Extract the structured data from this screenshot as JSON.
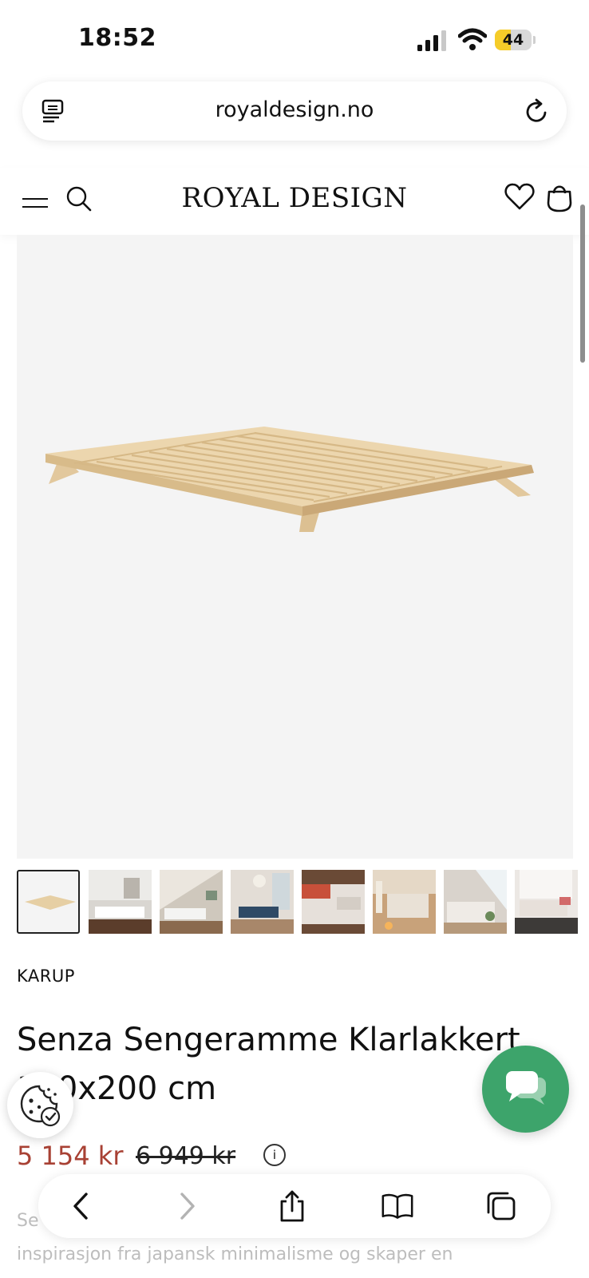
{
  "status_bar": {
    "time": "18:52",
    "battery": "44",
    "battery_level_percent": 44
  },
  "browser": {
    "url": "royaldesign.no"
  },
  "site": {
    "logo": "ROYAL DESIGN"
  },
  "product": {
    "brand": "KARUP",
    "title": "Senza Sengeramme Klarlakkert, 160x200 cm",
    "price": "5 154 kr",
    "old_price": "6 949 kr",
    "info_symbol": "i",
    "description_line1": "Se",
    "description_line2": "inspirasjon fra japansk minimalisme og skaper en"
  },
  "gallery": {
    "thumbnail_count": 8,
    "active_index": 0
  },
  "colors": {
    "sale_red": "#a84134",
    "chat_green": "#3da46b",
    "battery_yellow": "#f5cc29"
  },
  "icons": [
    "reader-icon",
    "reload-icon",
    "menu-icon",
    "search-icon",
    "heart-icon",
    "bag-icon",
    "chat-icon",
    "cookie-icon",
    "back-icon",
    "forward-icon",
    "share-icon",
    "bookmarks-icon",
    "tabs-icon"
  ]
}
